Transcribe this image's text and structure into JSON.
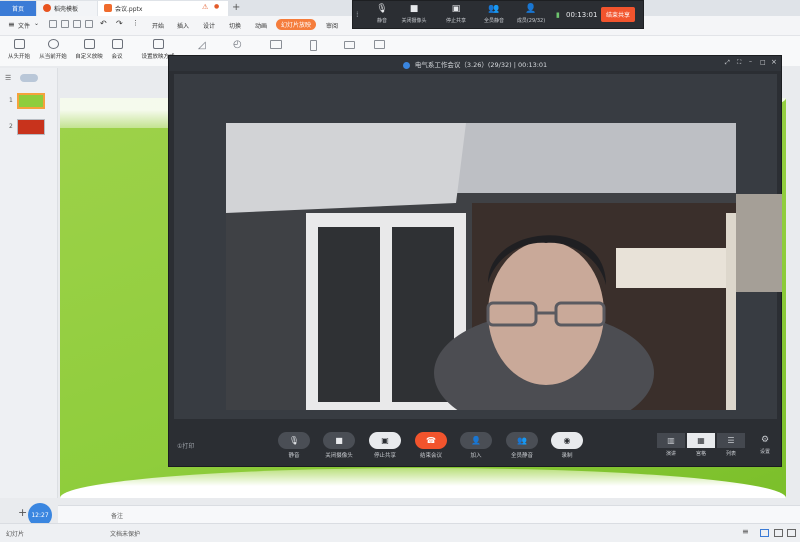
{
  "tabs": {
    "home": "首页",
    "templates": "稻壳模板",
    "pptx": "会议.pptx",
    "warning_icon": "warning-icon",
    "add": "+"
  },
  "menu": {
    "file": "文件",
    "items": [
      "开始",
      "插入",
      "设计",
      "切换",
      "动画",
      "幻灯片放映",
      "审阅"
    ]
  },
  "ribbon": {
    "tools": [
      "从头开始",
      "从当前开始",
      "自定义放映",
      "会议",
      "设置放映方式"
    ]
  },
  "slides": {
    "nums": [
      "1",
      "2"
    ]
  },
  "meeting": {
    "title": "电气系工作会议（3.26）(29/32) | 00:13:01",
    "record_label": "①打印",
    "controls": [
      "静音",
      "关闭摄像头",
      "停止共享",
      "结束会议",
      "加入",
      "全员静音",
      "录制"
    ],
    "views": [
      "演讲",
      "宫格",
      "列表"
    ],
    "settings": "设置"
  },
  "float_toolbar": {
    "items": [
      "静音",
      "关闭摄像头",
      "停止共享",
      "全员静音",
      "成员(29/32)"
    ],
    "timer": "00:13:01",
    "end_share": "结束共享"
  },
  "notes": {
    "label": "备注"
  },
  "status": {
    "slides": "幻灯片",
    "protect": "文档未保护",
    "clock": "12:27"
  },
  "colors": {
    "accent": "#f57d3c",
    "slide_green": "#8fcd3c",
    "end_red": "#f2542d",
    "wps_blue": "#3b7bd6"
  }
}
